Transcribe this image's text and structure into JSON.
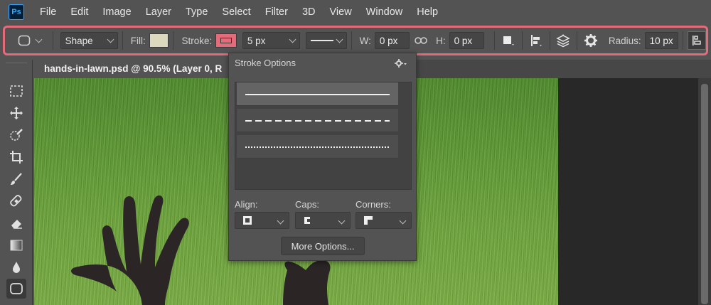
{
  "menubar": {
    "logo": "Ps",
    "items": [
      "File",
      "Edit",
      "Image",
      "Layer",
      "Type",
      "Select",
      "Filter",
      "3D",
      "View",
      "Window",
      "Help"
    ]
  },
  "options": {
    "mode_value": "Shape",
    "fill_label": "Fill:",
    "fill_color": "#dcd8c0",
    "stroke_label": "Stroke:",
    "stroke_color": "#e36b7a",
    "stroke_width": "5 px",
    "width_label": "W:",
    "width_value": "0 px",
    "height_label": "H:",
    "height_value": "0 px",
    "radius_label": "Radius:",
    "radius_value": "10 px"
  },
  "document": {
    "tab_title": "hands-in-lawn.psd @ 90.5% (Layer 0, R"
  },
  "stroke_popup": {
    "title": "Stroke Options",
    "styles": [
      "solid",
      "dashed",
      "dotted"
    ],
    "align_label": "Align:",
    "caps_label": "Caps:",
    "corners_label": "Corners:",
    "more_options_label": "More Options..."
  },
  "colors": {
    "highlight": "#e36b7a",
    "ps_blue": "#31a8ff",
    "grass": "#5f9b34",
    "silhouette": "#2b2526"
  }
}
